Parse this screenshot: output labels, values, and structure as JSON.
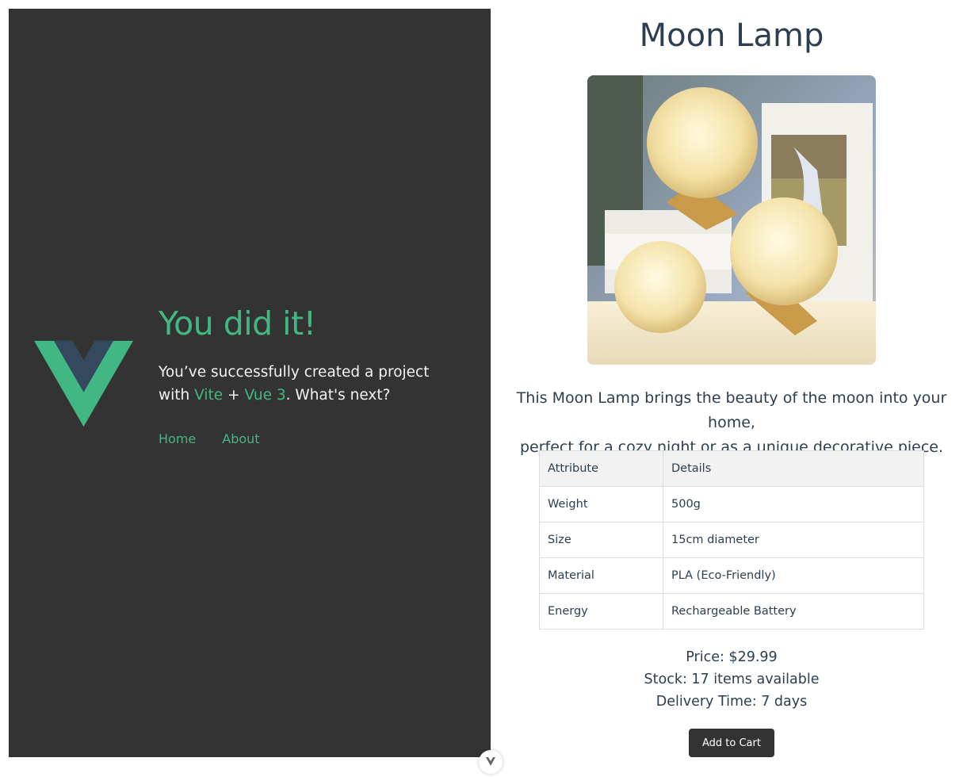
{
  "hero": {
    "heading": "You did it!",
    "line1": "You’ve successfully created a project",
    "with": "with",
    "vite": "Vite",
    "plus": "+",
    "vue": "Vue 3",
    "tail": ". What's next?"
  },
  "nav": {
    "home": "Home",
    "about": "About"
  },
  "product": {
    "title": "Moon Lamp",
    "image_alt": "Moon lamps",
    "description_line1": "This Moon Lamp brings the beauty of the moon into your home,",
    "description_line2": "perfect for a cozy night or as a unique decorative piece.",
    "table": {
      "headers": [
        "Attribute",
        "Details"
      ],
      "rows": [
        [
          "Weight",
          "500g"
        ],
        [
          "Size",
          "15cm diameter"
        ],
        [
          "Material",
          "PLA (Eco-Friendly)"
        ],
        [
          "Energy",
          "Rechargeable Battery"
        ]
      ]
    },
    "price": "Price: $29.99",
    "stock": "Stock: 17 items available",
    "delivery": "Delivery Time: 7 days",
    "add_to_cart": "Add to Cart"
  },
  "colors": {
    "accent": "#41b883",
    "dark_panel": "#333333",
    "vue_navy": "#35495e",
    "text": "#2c3e50"
  }
}
